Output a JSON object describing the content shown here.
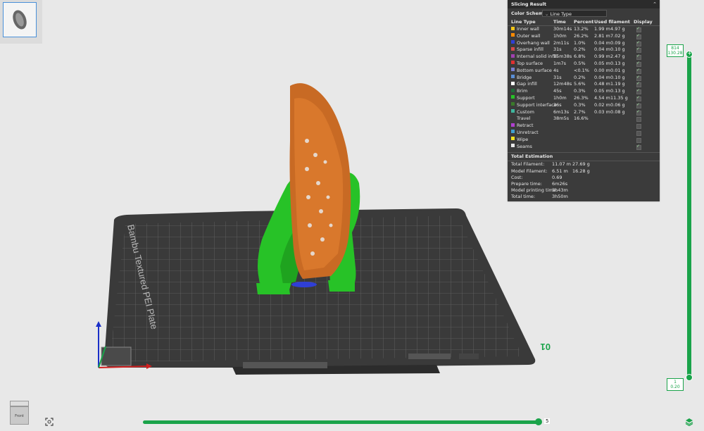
{
  "panel": {
    "title": "Slicing Result",
    "color_scheme_label": "Color Scheme",
    "color_scheme_value": "Line Type",
    "columns": [
      "Line Type",
      "Time",
      "Percent",
      "Used filament",
      "Display"
    ],
    "rows": [
      {
        "name": "Inner wall",
        "time": "30m14s",
        "percent": "13.2%",
        "meters": "1.99 m",
        "grams": "4.97 g",
        "color": "#f0c419",
        "display": true
      },
      {
        "name": "Outer wall",
        "time": "1h0m",
        "percent": "26.2%",
        "meters": "2.81 m",
        "grams": "7.02 g",
        "color": "#ff8a00",
        "display": true
      },
      {
        "name": "Overhang wall",
        "time": "2m11s",
        "percent": "1.0%",
        "meters": "0.04 m",
        "grams": "0.09 g",
        "color": "#2f3fd6",
        "display": true
      },
      {
        "name": "Sparse infill",
        "time": "31s",
        "percent": "0.2%",
        "meters": "0.04 m",
        "grams": "0.10 g",
        "color": "#d64a4a",
        "display": true
      },
      {
        "name": "Internal solid infill",
        "time": "15m38s",
        "percent": "6.8%",
        "meters": "0.99 m",
        "grams": "2.47 g",
        "color": "#a040b0",
        "display": true
      },
      {
        "name": "Top surface",
        "time": "1m7s",
        "percent": "0.5%",
        "meters": "0.05 m",
        "grams": "0.13 g",
        "color": "#e03030",
        "display": true
      },
      {
        "name": "Bottom surface",
        "time": "4s",
        "percent": "<0.1%",
        "meters": "0.00 m",
        "grams": "0.01 g",
        "color": "#7a7fd0",
        "display": true
      },
      {
        "name": "Bridge",
        "time": "31s",
        "percent": "0.2%",
        "meters": "0.04 m",
        "grams": "0.10 g",
        "color": "#5a8fd6",
        "display": true
      },
      {
        "name": "Gap infill",
        "time": "12m48s",
        "percent": "5.6%",
        "meters": "0.48 m",
        "grams": "1.19 g",
        "color": "#ffffff",
        "display": true
      },
      {
        "name": "Brim",
        "time": "45s",
        "percent": "0.3%",
        "meters": "0.05 m",
        "grams": "0.13 g",
        "color": "#1f6b3a",
        "display": true
      },
      {
        "name": "Support",
        "time": "1h0m",
        "percent": "26.3%",
        "meters": "4.54 m",
        "grams": "11.35 g",
        "color": "#27c227",
        "display": true
      },
      {
        "name": "Support interface",
        "time": "36s",
        "percent": "0.3%",
        "meters": "0.02 m",
        "grams": "0.06 g",
        "color": "#3a7a2a",
        "display": true
      },
      {
        "name": "Custom",
        "time": "6m13s",
        "percent": "2.7%",
        "meters": "0.03 m",
        "grams": "0.08 g",
        "color": "#3fb59d",
        "display": true
      },
      {
        "name": "Travel",
        "time": "38m5s",
        "percent": "16.6%",
        "meters": "",
        "grams": "",
        "color": "#3a3a3a",
        "display": false
      },
      {
        "name": "Retract",
        "time": "",
        "percent": "",
        "meters": "",
        "grams": "",
        "color": "#b040d0",
        "display": false
      },
      {
        "name": "Unretract",
        "time": "",
        "percent": "",
        "meters": "",
        "grams": "",
        "color": "#40a0d0",
        "display": false
      },
      {
        "name": "Wipe",
        "time": "",
        "percent": "",
        "meters": "",
        "grams": "",
        "color": "#f0e020",
        "display": false
      },
      {
        "name": "Seams",
        "time": "",
        "percent": "",
        "meters": "",
        "grams": "",
        "color": "#e8e8e8",
        "display": true
      }
    ],
    "total_title": "Total Estimation",
    "totals": [
      {
        "label": "Total Filament:",
        "v1": "11.07 m",
        "v2": "27.69 g"
      },
      {
        "label": "Model Filament:",
        "v1": "6.51 m",
        "v2": "16.28 g"
      },
      {
        "label": "Cost:",
        "v1": "0.69",
        "v2": ""
      },
      {
        "label": "Prepare time:",
        "v1": "6m26s",
        "v2": ""
      },
      {
        "label": "Model printing time:",
        "v1": "3h43m",
        "v2": ""
      },
      {
        "label": "Total time:",
        "v1": "3h50m",
        "v2": ""
      }
    ]
  },
  "layer_slider": {
    "top_layer": "814",
    "top_height": "130.28",
    "bottom_layer": "1",
    "bottom_height": "0.20"
  },
  "move_slider": {
    "value": "5"
  },
  "plate": {
    "label": "Bambu Textured PEI Plate",
    "number": "01"
  },
  "view_cube": {
    "face_label": "Front"
  },
  "icons": [
    "view-cube-icon",
    "fit-view-icon",
    "layers-icon",
    "collapse-icon"
  ],
  "colors": {
    "accent": "#1aa34a",
    "panel_bg": "#3b3b3b"
  }
}
